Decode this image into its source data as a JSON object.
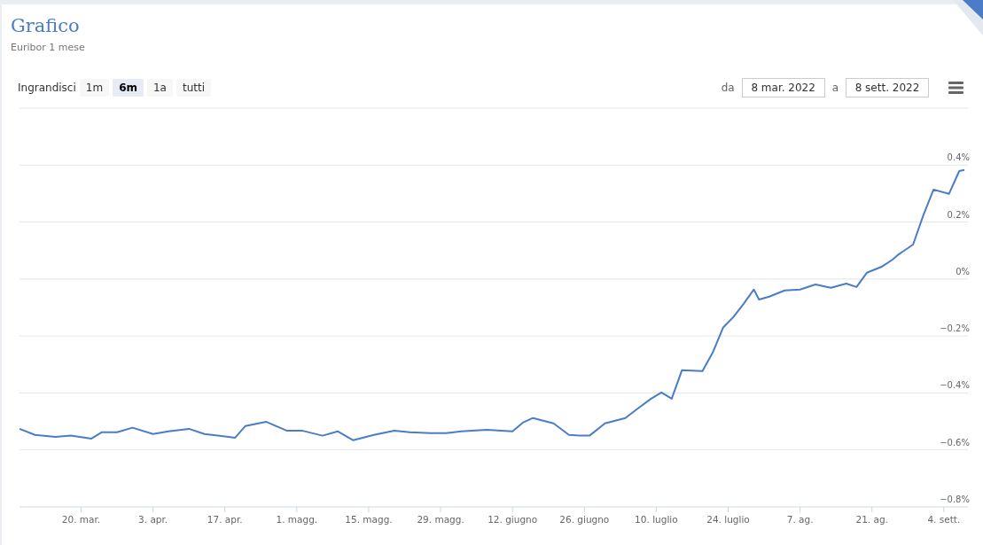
{
  "title": "Grafico",
  "subtitle": "Euribor 1 mese",
  "zoom": {
    "label": "Ingrandisci",
    "buttons": [
      {
        "label": "1m",
        "selected": false
      },
      {
        "label": "6m",
        "selected": true
      },
      {
        "label": "1a",
        "selected": false
      },
      {
        "label": "tutti",
        "selected": false
      }
    ]
  },
  "range": {
    "from_label": "da",
    "from": "8 mar. 2022",
    "to_label": "a",
    "to": "8 sett. 2022"
  },
  "chart_data": {
    "type": "line",
    "grid": true,
    "xlim": [
      "2022-03-08",
      "2022-09-08"
    ],
    "ylim": [
      -0.8,
      0.6
    ],
    "x": [
      "2022-03-08",
      "2022-03-11",
      "2022-03-15",
      "2022-03-18",
      "2022-03-22",
      "2022-03-24",
      "2022-03-27",
      "2022-03-30",
      "2022-04-03",
      "2022-04-06",
      "2022-04-10",
      "2022-04-13",
      "2022-04-19",
      "2022-04-21",
      "2022-04-25",
      "2022-04-29",
      "2022-05-02",
      "2022-05-06",
      "2022-05-09",
      "2022-05-12",
      "2022-05-16",
      "2022-05-20",
      "2022-05-23",
      "2022-05-27",
      "2022-05-30",
      "2022-06-02",
      "2022-06-07",
      "2022-06-12",
      "2022-06-14",
      "2022-06-16",
      "2022-06-20",
      "2022-06-23",
      "2022-06-25",
      "2022-06-27",
      "2022-06-30",
      "2022-07-04",
      "2022-07-06",
      "2022-07-09",
      "2022-07-11",
      "2022-07-13",
      "2022-07-15",
      "2022-07-19",
      "2022-07-21",
      "2022-07-23",
      "2022-07-25",
      "2022-07-27",
      "2022-07-29",
      "2022-07-30",
      "2022-08-01",
      "2022-08-04",
      "2022-08-07",
      "2022-08-10",
      "2022-08-13",
      "2022-08-16",
      "2022-08-18",
      "2022-08-20",
      "2022-08-23",
      "2022-08-25",
      "2022-08-26",
      "2022-08-29",
      "2022-08-31",
      "2022-09-02",
      "2022-09-05",
      "2022-09-07",
      "2022-09-08"
    ],
    "series": [
      {
        "color": "#4a7cc7",
        "values": [
          -0.526,
          -0.547,
          -0.554,
          -0.55,
          -0.56,
          -0.538,
          -0.538,
          -0.522,
          -0.544,
          -0.535,
          -0.526,
          -0.544,
          -0.557,
          -0.516,
          -0.501,
          -0.532,
          -0.532,
          -0.55,
          -0.535,
          -0.566,
          -0.547,
          -0.532,
          -0.538,
          -0.541,
          -0.541,
          -0.535,
          -0.529,
          -0.535,
          -0.504,
          -0.488,
          -0.507,
          -0.547,
          -0.55,
          -0.55,
          -0.507,
          -0.488,
          -0.46,
          -0.42,
          -0.398,
          -0.42,
          -0.32,
          -0.323,
          -0.258,
          -0.171,
          -0.134,
          -0.087,
          -0.037,
          -0.072,
          -0.062,
          -0.04,
          -0.037,
          -0.019,
          -0.031,
          -0.016,
          -0.028,
          0.022,
          0.044,
          0.068,
          0.084,
          0.121,
          0.224,
          0.314,
          0.299,
          0.379,
          0.383
        ]
      }
    ],
    "xticks": [
      {
        "value": "2022-03-20",
        "label": "20. mar."
      },
      {
        "value": "2022-04-03",
        "label": "3. apr."
      },
      {
        "value": "2022-04-17",
        "label": "17. apr."
      },
      {
        "value": "2022-05-01",
        "label": "1. magg."
      },
      {
        "value": "2022-05-15",
        "label": "15. magg."
      },
      {
        "value": "2022-05-29",
        "label": "29. magg."
      },
      {
        "value": "2022-06-12",
        "label": "12. giugno"
      },
      {
        "value": "2022-06-26",
        "label": "26. giugno"
      },
      {
        "value": "2022-07-10",
        "label": "10. luglio"
      },
      {
        "value": "2022-07-24",
        "label": "24. luglio"
      },
      {
        "value": "2022-08-07",
        "label": "7. ag."
      },
      {
        "value": "2022-08-21",
        "label": "21. ag."
      },
      {
        "value": "2022-09-04",
        "label": "4. sett."
      }
    ],
    "yticks": [
      {
        "value": -0.8,
        "label": "−0.8%"
      },
      {
        "value": -0.6,
        "label": "−0.6%"
      },
      {
        "value": -0.4,
        "label": "−0.4%"
      },
      {
        "value": -0.2,
        "label": "−0.2%"
      },
      {
        "value": 0,
        "label": "0%"
      },
      {
        "value": 0.2,
        "label": "0.2%"
      },
      {
        "value": 0.4,
        "label": "0.4%"
      }
    ]
  }
}
